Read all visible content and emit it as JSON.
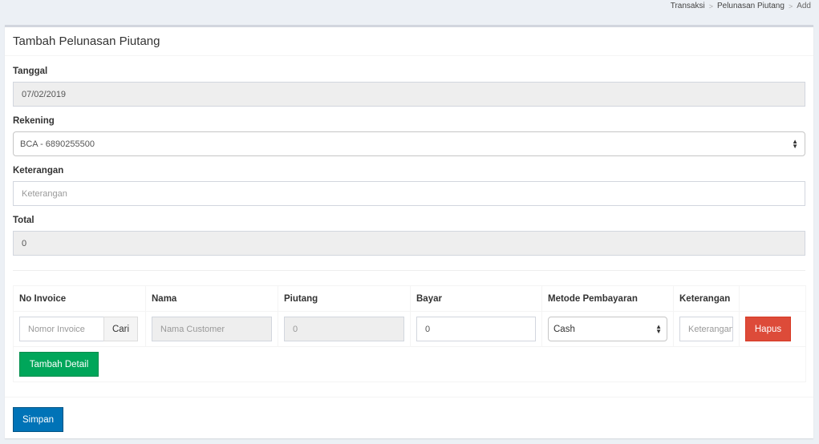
{
  "breadcrumb": {
    "items": [
      "Transaksi",
      "Pelunasan Piutang",
      "Add"
    ],
    "separator": ">"
  },
  "box": {
    "title": "Tambah Pelunasan Piutang"
  },
  "form": {
    "tanggal": {
      "label": "Tanggal",
      "value": "07/02/2019"
    },
    "rekening": {
      "label": "Rekening",
      "value": "BCA - 6890255500"
    },
    "keterangan": {
      "label": "Keterangan",
      "placeholder": "Keterangan"
    },
    "total": {
      "label": "Total",
      "value": "0"
    }
  },
  "detail_table": {
    "headers": [
      "No Invoice",
      "Nama",
      "Piutang",
      "Bayar",
      "Metode Pembayaran",
      "Keterangan",
      ""
    ],
    "row": {
      "invoice_placeholder": "Nomor Invoice",
      "cari_label": "Cari",
      "nama_placeholder": "Nama Customer",
      "piutang_value": "0",
      "bayar_value": "0",
      "metode_value": "Cash",
      "keterangan_placeholder": "Keterangan",
      "hapus_label": "Hapus"
    },
    "tambah_label": "Tambah Detail"
  },
  "footer": {
    "simpan_label": "Simpan"
  },
  "colors": {
    "primary": "#0073b7",
    "success": "#00a65a",
    "danger": "#dd4b39"
  }
}
